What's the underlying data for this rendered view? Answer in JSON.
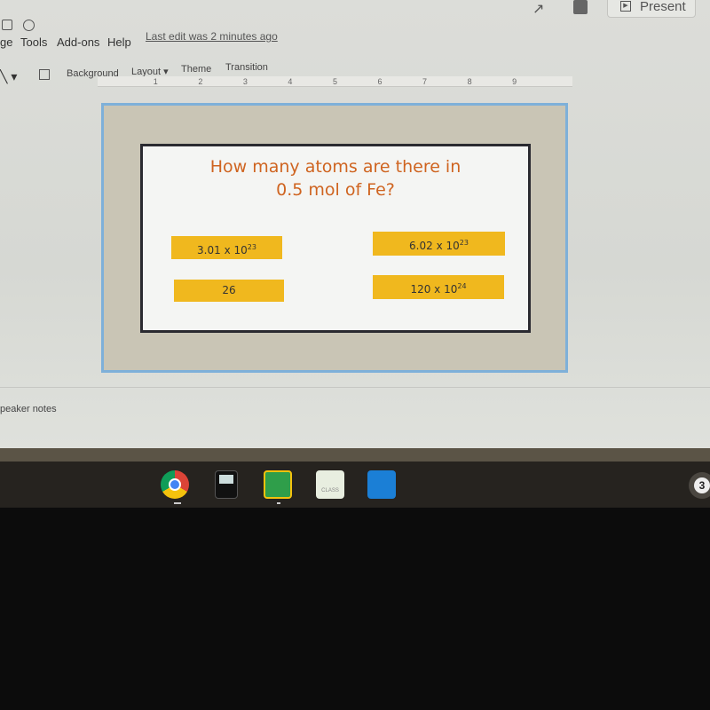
{
  "menu": {
    "items": [
      "ge",
      "Tools",
      "Add-ons",
      "Help"
    ],
    "last_edit": "Last edit was 2 minutes ago"
  },
  "toolbar": {
    "background": "Background",
    "layout": "Layout ▾",
    "theme": "Theme",
    "transition": "Transition"
  },
  "header": {
    "present": "Present"
  },
  "ruler": [
    "1",
    "2",
    "3",
    "4",
    "5",
    "6",
    "7",
    "8",
    "9"
  ],
  "slide": {
    "question_line1": "How many atoms are there in",
    "question_line2": "0.5 mol of Fe?",
    "answers": [
      {
        "base": "3.01 x 10",
        "exp": "23"
      },
      {
        "base": "6.02 x 10",
        "exp": "23"
      },
      {
        "base": "26",
        "exp": ""
      },
      {
        "base": "120 x 10",
        "exp": "24"
      }
    ]
  },
  "notes": {
    "label": "peaker notes"
  },
  "shelf": {
    "apps": [
      "chrome",
      "calculator",
      "google-classroom",
      "class",
      "shield"
    ],
    "notification_count": "3"
  },
  "colors": {
    "question": "#cf6420",
    "answer": "#f0b81e",
    "slide_border": "#7eb0d9"
  }
}
